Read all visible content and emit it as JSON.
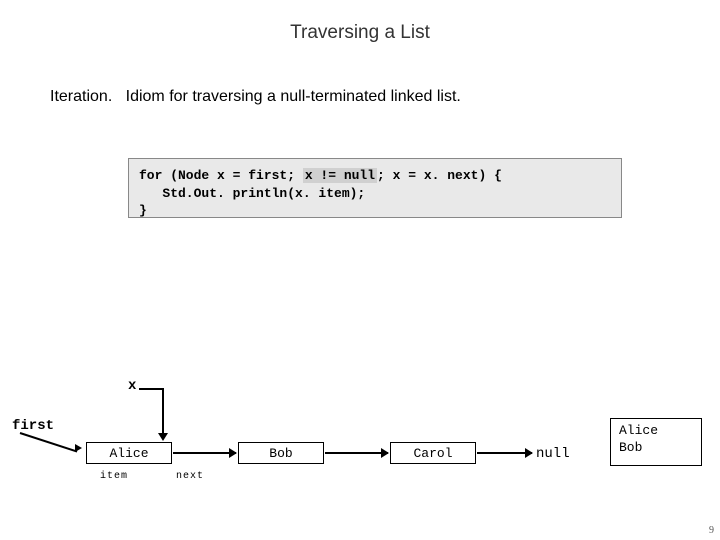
{
  "title": "Traversing a List",
  "subtitle": {
    "lead": "Iteration.",
    "rest": "Idiom for traversing a null-terminated linked list."
  },
  "code": {
    "l1a": "for (Node x = first; ",
    "l1b": "x != null",
    "l1c": "; x = x. next) {",
    "l2": "   Std.Out. println(x. item);",
    "l3": "}"
  },
  "diagram": {
    "x": "x",
    "first": "first",
    "nodes": [
      "Alice",
      "Bob",
      "Carol"
    ],
    "null": "null",
    "item": "item",
    "next": "next"
  },
  "output": {
    "l1": "Alice",
    "l2": "Bob"
  },
  "page": "9"
}
